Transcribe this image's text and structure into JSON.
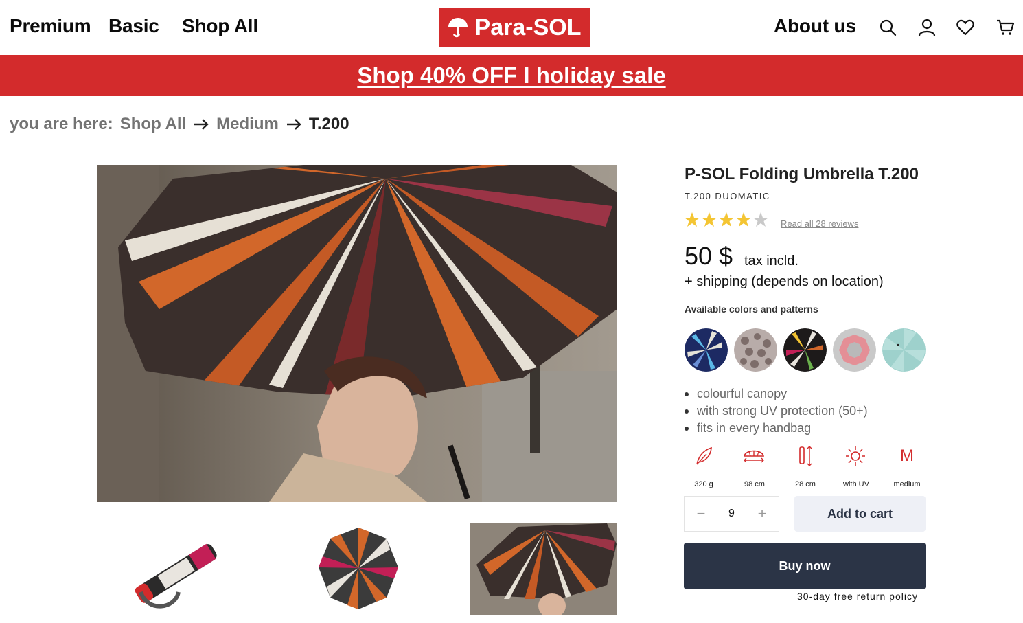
{
  "header": {
    "nav_left": [
      "Premium",
      "Basic",
      "Shop All"
    ],
    "logo_text": "Para-SOL",
    "about_label": "About us",
    "icons": [
      "search-icon",
      "user-icon",
      "heart-icon",
      "cart-icon"
    ]
  },
  "banner": {
    "text": "Shop 40% OFF I holiday sale"
  },
  "breadcrumb": {
    "prefix": "you are here:",
    "items": [
      "Shop All",
      "Medium",
      "T.200"
    ]
  },
  "product": {
    "title": "P-SOL Folding Umbrella T.200",
    "subtitle": "T.200 DUOMATIC",
    "rating": 4,
    "rating_max": 5,
    "reviews_link": "Read all 28 reviews",
    "price": "50 $",
    "tax_note": "tax incld.",
    "shipping_note": "+ shipping (depends on location)",
    "colors_label": "Available colors and patterns",
    "features": [
      "colourful canopy",
      "with strong UV protection (50+)",
      "fits in every handbag"
    ],
    "specs": [
      {
        "icon": "feather-weight-icon",
        "label": "320 g"
      },
      {
        "icon": "umbrella-diameter-icon",
        "label": "98 cm"
      },
      {
        "icon": "folded-length-icon",
        "label": "28 cm"
      },
      {
        "icon": "sun-uv-icon",
        "label": "with UV"
      },
      {
        "icon": "size-m-icon",
        "glyph": "M",
        "label": "medium"
      }
    ],
    "quantity": "9",
    "qty_minus": "−",
    "qty_plus": "+",
    "add_to_cart": "Add to cart",
    "buy_now": "Buy now",
    "return_policy": "30-day free return policy"
  },
  "colors": {
    "accent": "#d32b2c",
    "dark_button": "#2b3446",
    "light_button": "#eef0f6",
    "star": "#f4c533"
  }
}
